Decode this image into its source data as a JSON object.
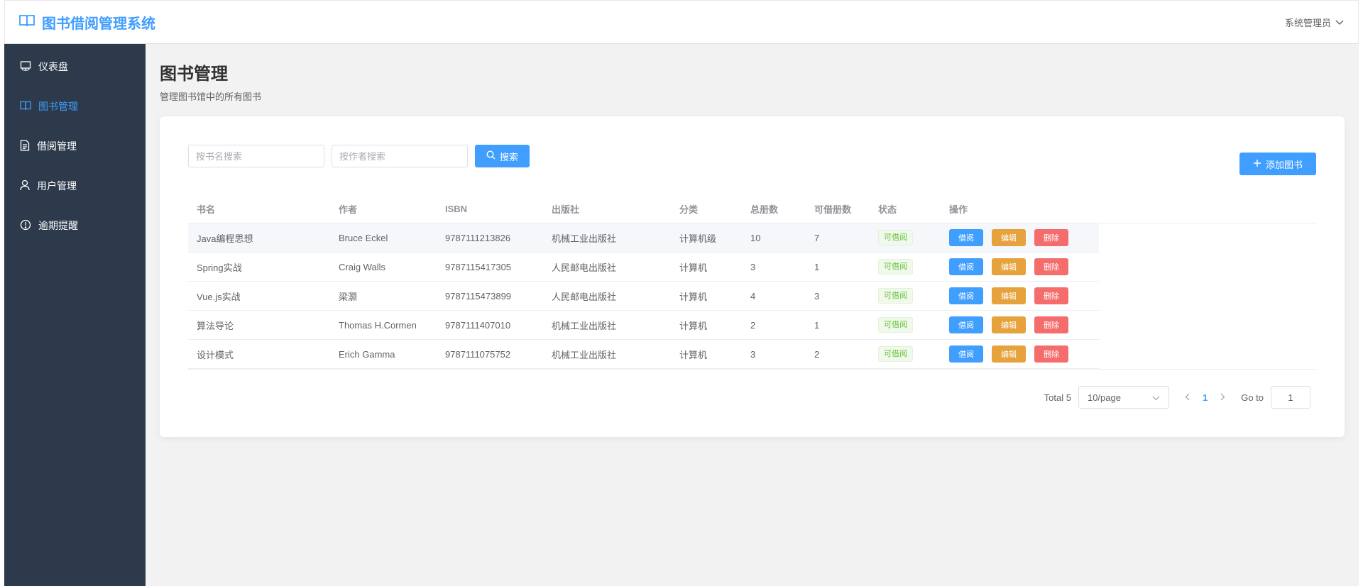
{
  "header": {
    "app_title": "图书借阅管理系统",
    "user_label": "系统管理员"
  },
  "sidebar": {
    "items": [
      {
        "label": "仪表盘",
        "icon": "dashboard-icon"
      },
      {
        "label": "图书管理",
        "icon": "book-icon",
        "active": true
      },
      {
        "label": "借阅管理",
        "icon": "document-icon"
      },
      {
        "label": "用户管理",
        "icon": "user-icon"
      },
      {
        "label": "逾期提醒",
        "icon": "warning-icon"
      }
    ]
  },
  "page": {
    "title": "图书管理",
    "description": "管理图书馆中的所有图书"
  },
  "toolbar": {
    "title_search_placeholder": "按书名搜索",
    "author_search_placeholder": "按作者搜索",
    "search_label": "搜索",
    "add_label": "添加图书"
  },
  "table": {
    "columns": [
      "书名",
      "作者",
      "ISBN",
      "出版社",
      "分类",
      "总册数",
      "可借册数",
      "状态",
      "操作"
    ],
    "rows": [
      {
        "name": "Java编程思想",
        "author": "Bruce Eckel",
        "isbn": "9787111213826",
        "publisher": "机械工业出版社",
        "category": "计算机级",
        "total": "10",
        "available": "7",
        "status": "可借阅"
      },
      {
        "name": "Spring实战",
        "author": "Craig Walls",
        "isbn": "9787115417305",
        "publisher": "人民邮电出版社",
        "category": "计算机",
        "total": "3",
        "available": "1",
        "status": "可借阅"
      },
      {
        "name": "Vue.js实战",
        "author": "梁灏",
        "isbn": "9787115473899",
        "publisher": "人民邮电出版社",
        "category": "计算机",
        "total": "4",
        "available": "3",
        "status": "可借阅"
      },
      {
        "name": "算法导论",
        "author": "Thomas H.Cormen",
        "isbn": "9787111407010",
        "publisher": "机械工业出版社",
        "category": "计算机",
        "total": "2",
        "available": "1",
        "status": "可借阅"
      },
      {
        "name": "设计模式",
        "author": "Erich Gamma",
        "isbn": "9787111075752",
        "publisher": "机械工业出版社",
        "category": "计算机",
        "total": "3",
        "available": "2",
        "status": "可借阅"
      }
    ],
    "actions": {
      "borrow": "借阅",
      "edit": "编辑",
      "delete": "删除"
    }
  },
  "pagination": {
    "total_label": "Total 5",
    "page_size": "10/page",
    "current_page": "1",
    "goto_label": "Go to",
    "goto_value": "1"
  },
  "colors": {
    "primary": "#409eff",
    "warning": "#e6a23c",
    "danger": "#f56c6c",
    "success": "#67c23a",
    "sidebar_bg": "#2d3a4b"
  }
}
